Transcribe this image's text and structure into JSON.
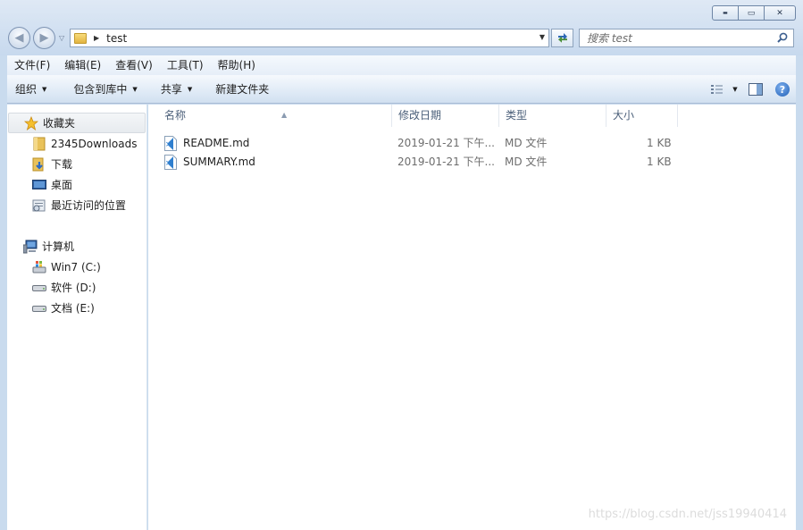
{
  "window": {
    "buttons": {
      "minimize": "▬",
      "maximize": "▭",
      "close": "✕"
    }
  },
  "address": {
    "crumb": "test",
    "refresh_icon": "refresh-icon"
  },
  "search": {
    "placeholder": "搜索 test"
  },
  "menu": [
    {
      "label": "文件(F)"
    },
    {
      "label": "编辑(E)"
    },
    {
      "label": "查看(V)"
    },
    {
      "label": "工具(T)"
    },
    {
      "label": "帮助(H)"
    }
  ],
  "toolbar": {
    "organize": "组织",
    "include_in_library": "包含到库中",
    "share": "共享",
    "new_folder": "新建文件夹",
    "help": "?"
  },
  "sidebar": {
    "favorites": "收藏夹",
    "items": [
      {
        "label": "2345Downloads"
      },
      {
        "label": "下载"
      },
      {
        "label": "桌面"
      },
      {
        "label": "最近访问的位置"
      }
    ],
    "computer": "计算机",
    "drives": [
      {
        "label": "Win7 (C:)"
      },
      {
        "label": "软件 (D:)"
      },
      {
        "label": "文档 (E:)"
      }
    ]
  },
  "columns": {
    "name": "名称",
    "modified": "修改日期",
    "type": "类型",
    "size": "大小"
  },
  "files": [
    {
      "name": "README.md",
      "modified": "2019-01-21 下午...",
      "type": "MD 文件",
      "size": "1 KB"
    },
    {
      "name": "SUMMARY.md",
      "modified": "2019-01-21 下午...",
      "type": "MD 文件",
      "size": "1 KB"
    }
  ],
  "watermark": "https://blog.csdn.net/jss19940414"
}
